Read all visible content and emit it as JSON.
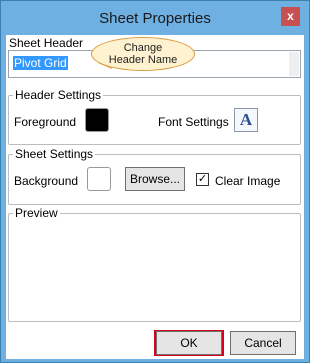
{
  "window": {
    "title": "Sheet Properties",
    "close_label": "x"
  },
  "sheet_header": {
    "label": "Sheet Header",
    "value": "Pivot Grid"
  },
  "callout": {
    "text_line1": "Change",
    "text_line2": "Header Name"
  },
  "header_settings": {
    "title": "Header Settings",
    "foreground_label": "Foreground",
    "foreground_color": "#000000",
    "font_settings_label": "Font Settings",
    "font_icon_glyph": "A"
  },
  "sheet_settings": {
    "title": "Sheet Settings",
    "background_label": "Background",
    "background_color": "#ffffff",
    "browse_label": "Browse...",
    "clear_image_label": "Clear Image",
    "clear_image_checked": true
  },
  "preview": {
    "title": "Preview"
  },
  "footer": {
    "ok_label": "OK",
    "cancel_label": "Cancel"
  },
  "colors": {
    "title_bar": "#6fb0e3",
    "close_button": "#c75050",
    "highlight": "#d9001b",
    "selection": "#3399ff"
  }
}
